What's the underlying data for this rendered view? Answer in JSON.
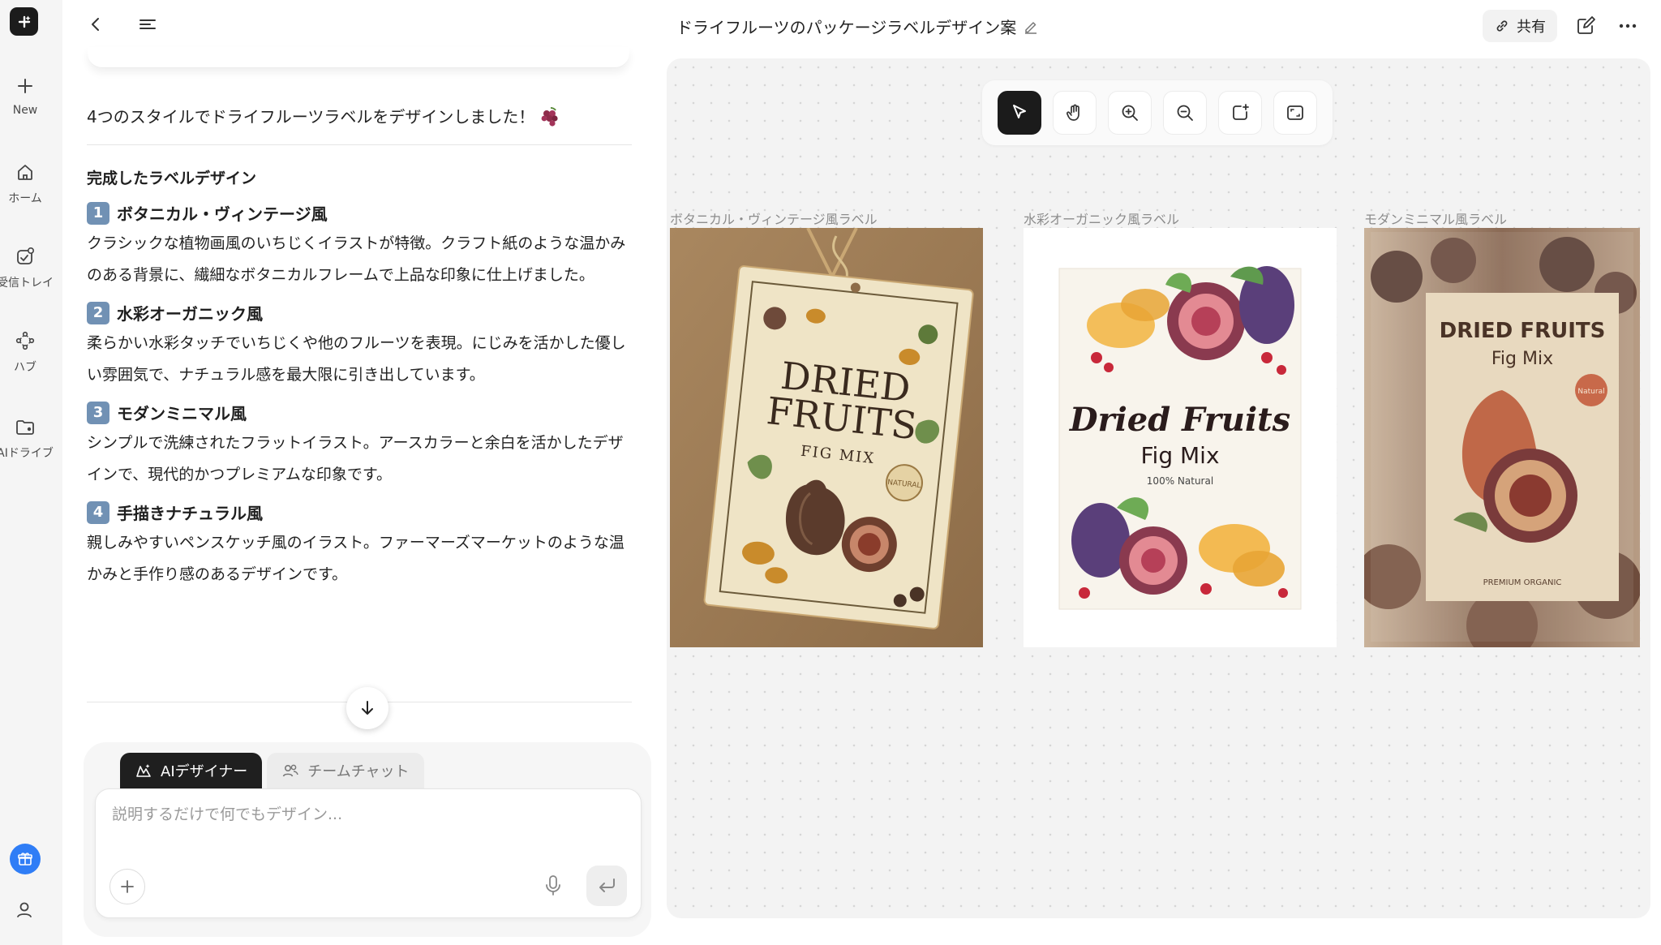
{
  "rail": {
    "new_label": "New",
    "home_label": "ホーム",
    "inbox_label": "受信トレイ",
    "hub_label": "ハブ",
    "drive_label": "AIドライブ"
  },
  "chat": {
    "intro": "4つのスタイルでドライフルーツラベルをデザインしました！",
    "section_title": "完成したラベルデザイン",
    "items": [
      {
        "num": "1",
        "title": "ボタニカル・ヴィンテージ風",
        "body": "クラシックな植物画風のいちじくイラストが特徴。クラフト紙のような温かみのある背景に、繊細なボタニカルフレームで上品な印象に仕上げました。"
      },
      {
        "num": "2",
        "title": "水彩オーガニック風",
        "body": "柔らかい水彩タッチでいちじくや他のフルーツを表現。にじみを活かした優しい雰囲気で、ナチュラル感を最大限に引き出しています。"
      },
      {
        "num": "3",
        "title": "モダンミニマル風",
        "body": "シンプルで洗練されたフラットイラスト。アースカラーと余白を活かしたデザインで、現代的かつプレミアムな印象です。"
      },
      {
        "num": "4",
        "title": "手描きナチュラル風",
        "body": "親しみやすいペンスケッチ風のイラスト。ファーマーズマーケットのような温かみと手作り感のあるデザインです。"
      }
    ]
  },
  "composer": {
    "tab_ai": "AIデザイナー",
    "tab_team": "チームチャット",
    "placeholder": "説明するだけで何でもデザイン..."
  },
  "header": {
    "title": "ドライフルーツのパッケージラベルデザイン案",
    "share_label": "共有"
  },
  "canvas": {
    "frames": [
      {
        "label": "ボタニカル・ヴィンテージ風ラベル",
        "line1": "DRIED",
        "line2": "FRUITS",
        "sub": "FIG MIX",
        "badge": "NATURAL"
      },
      {
        "label": "水彩オーガニック風ラベル",
        "title": "Dried Fruits",
        "sub": "Fig Mix",
        "note": "100% Natural"
      },
      {
        "label": "モダンミニマル風ラベル",
        "title": "DRIED FRUITS",
        "sub": "Fig Mix",
        "badge": "Natural",
        "footer": "PREMIUM ORGANIC"
      }
    ]
  }
}
